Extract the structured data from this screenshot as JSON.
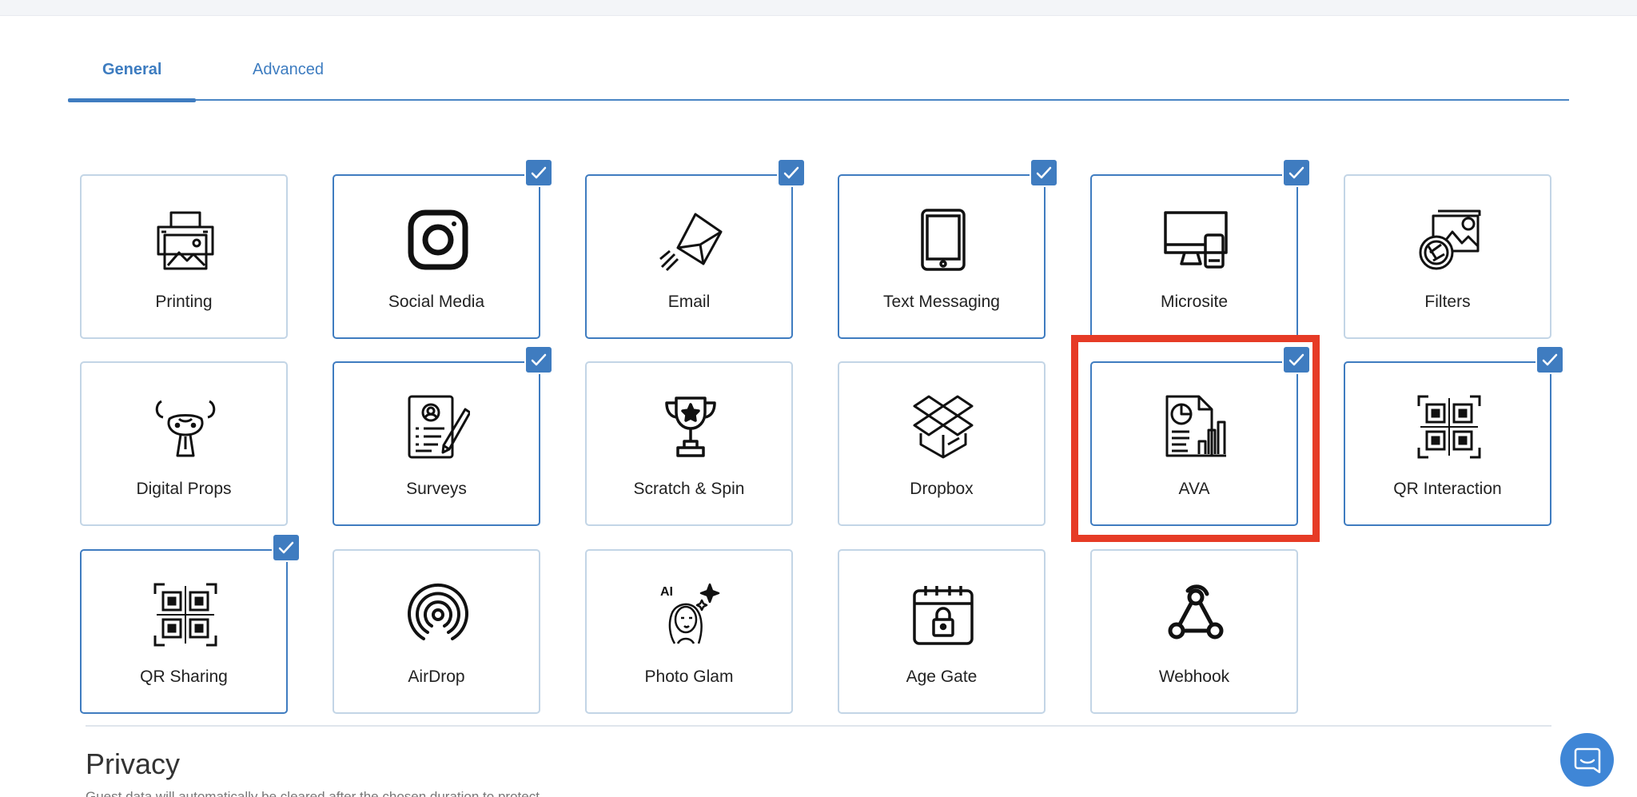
{
  "tabs": [
    {
      "label": "General",
      "active": true
    },
    {
      "label": "Advanced",
      "active": false
    }
  ],
  "features": [
    {
      "label": "Printing",
      "icon": "printer-icon",
      "enabled": false
    },
    {
      "label": "Social Media",
      "icon": "instagram-icon",
      "enabled": true
    },
    {
      "label": "Email",
      "icon": "envelope-icon",
      "enabled": true
    },
    {
      "label": "Text Messaging",
      "icon": "tablet-icon",
      "enabled": true
    },
    {
      "label": "Microsite",
      "icon": "monitor-icon",
      "enabled": true
    },
    {
      "label": "Filters",
      "icon": "image-filter-icon",
      "enabled": false
    },
    {
      "label": "Digital Props",
      "icon": "dog-mask-icon",
      "enabled": false
    },
    {
      "label": "Surveys",
      "icon": "survey-form-icon",
      "enabled": true
    },
    {
      "label": "Scratch & Spin",
      "icon": "trophy-icon",
      "enabled": false
    },
    {
      "label": "Dropbox",
      "icon": "dropbox-icon",
      "enabled": false
    },
    {
      "label": "AVA",
      "icon": "analytics-report-icon",
      "enabled": true
    },
    {
      "label": "QR Interaction",
      "icon": "qr-code-icon",
      "enabled": true
    },
    {
      "label": "QR Sharing",
      "icon": "qr-code-icon",
      "enabled": true
    },
    {
      "label": "AirDrop",
      "icon": "airdrop-icon",
      "enabled": false
    },
    {
      "label": "Photo Glam",
      "icon": "ai-portrait-icon",
      "enabled": false
    },
    {
      "label": "Age Gate",
      "icon": "calendar-lock-icon",
      "enabled": false
    },
    {
      "label": "Webhook",
      "icon": "webhook-icon",
      "enabled": false
    }
  ],
  "highlighted_feature": "AVA",
  "privacy": {
    "title": "Privacy",
    "subtitle": "Guest data will automatically be cleared after the chosen duration to protect"
  },
  "colors": {
    "accent": "#3f7cc0",
    "highlight": "#e63b26",
    "chat": "#3f86d6"
  }
}
